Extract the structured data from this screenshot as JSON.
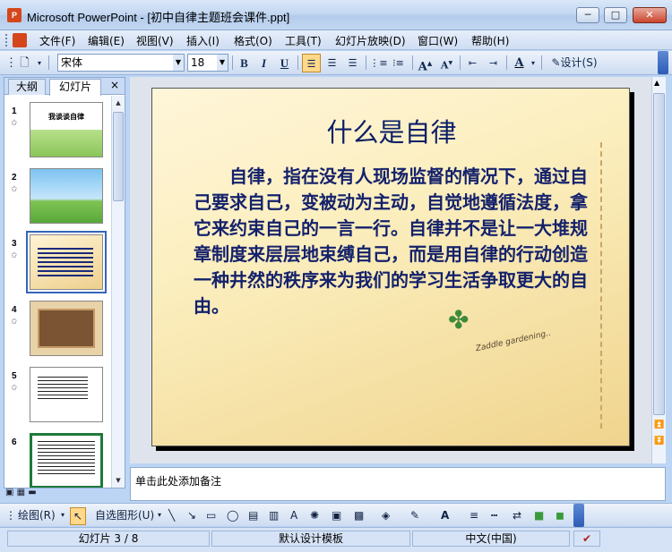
{
  "window": {
    "title": "Microsoft PowerPoint - [初中自律主题班会课件.ppt]"
  },
  "menu": {
    "items": [
      "文件(F)",
      "编辑(E)",
      "视图(V)",
      "插入(I)",
      "格式(O)",
      "工具(T)",
      "幻灯片放映(D)",
      "窗口(W)",
      "帮助(H)"
    ]
  },
  "toolbar": {
    "font_name": "宋体",
    "font_size": "18",
    "bold": "B",
    "italic": "I",
    "underline": "U",
    "design_label": "设计(S)"
  },
  "pane": {
    "tab_outline": "大纲",
    "tab_slides": "幻灯片",
    "close": "×",
    "thumbnails": [
      {
        "num": "1",
        "caption": "我谈谈自律"
      },
      {
        "num": "2",
        "caption": ""
      },
      {
        "num": "3",
        "caption": ""
      },
      {
        "num": "4",
        "caption": ""
      },
      {
        "num": "5",
        "caption": ""
      },
      {
        "num": "6",
        "caption": ""
      }
    ],
    "selected_index": 2
  },
  "slide": {
    "title": "什么是自律",
    "body": "自律，指在没有人现场监督的情况下，通过自己要求自己，变被动为主动，自觉地遵循法度，拿它来约束自己的一言一行。自律并不是让一大堆规章制度来层层地束缚自己，而是用自律的行动创造一种井然的秩序来为我们的学习生活争取更大的自由。",
    "handwriting": "Zaddle gardening.."
  },
  "notes": {
    "placeholder": "单击此处添加备注"
  },
  "drawbar": {
    "draw_label": "绘图(R)",
    "autoshape_label": "自选图形(U)"
  },
  "status": {
    "slide_info": "幻灯片 3 / 8",
    "template": "默认设计模板",
    "language": "中文(中国)"
  }
}
